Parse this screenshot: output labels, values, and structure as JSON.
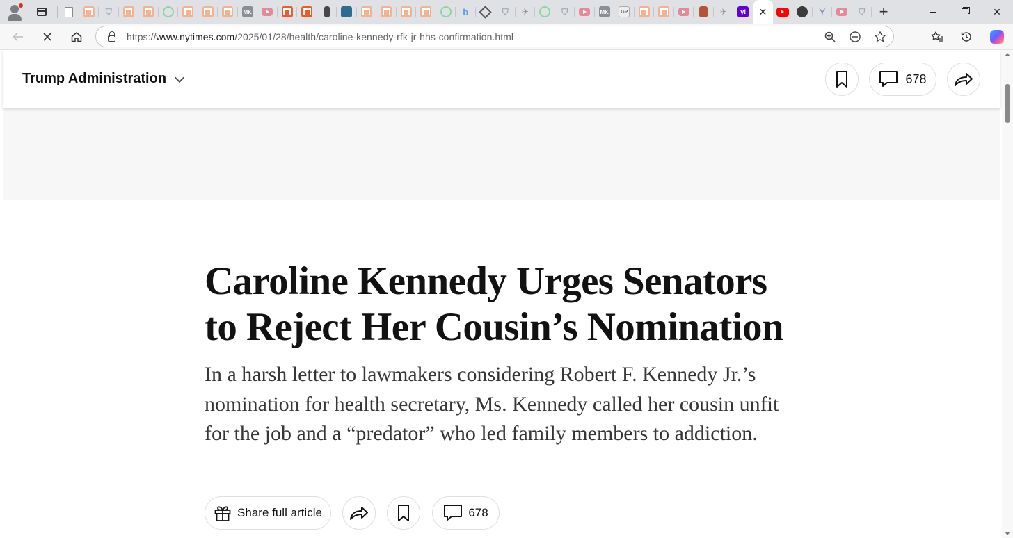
{
  "browser": {
    "url_prefix": "https://",
    "url_host": "www.nytimes.com",
    "url_path": "/2025/01/28/health/caroline-kennedy-rfk-jr-hhs-confirmation.html",
    "close_tab_glyph": "✕",
    "new_tab_glyph": "+",
    "window_close_glyph": "✕",
    "icons": [
      "back-icon",
      "stop-loading-icon",
      "home-icon",
      "lock-icon",
      "zoom-icon",
      "read-aloud-icon",
      "favorite-star-icon",
      "favorites-icon",
      "history-icon",
      "copilot-icon"
    ]
  },
  "tabstrip": {
    "favicons": [
      "doc",
      "orange",
      "shield",
      "orange",
      "orange",
      "play",
      "orange",
      "orange",
      "orange",
      "gray",
      "pinkred",
      "red-orange",
      "red-orange",
      "dark",
      "teal",
      "orange",
      "orange",
      "orange",
      "orange",
      "play",
      "blue-b",
      "diamond",
      "shield",
      "bird",
      "play",
      "shield",
      "pinkred",
      "gray",
      "gp",
      "orange",
      "orange",
      "pinkred",
      "brown",
      "bird",
      "purple"
    ],
    "favicon_labels": {
      "gray": "MK",
      "gp": "GP",
      "purple": "y!",
      "blue-b": "b"
    },
    "after_active": [
      "ytred",
      "circle-dark",
      "y",
      "pinkred",
      "shield"
    ]
  },
  "sticky_header": {
    "section_label": "Trump Administration",
    "comment_count": "678"
  },
  "article": {
    "headline": "Caroline Kennedy Urges Senators to Reject Her Cousin’s Nomination",
    "summary": "In a harsh letter to lawmakers considering Robert F. Kennedy Jr.’s nomination for health secretary, Ms. Kennedy called her cousin unfit for the job and a “predator” who led family members to addiction.",
    "share_full_article_label": "Share full article",
    "comment_count": "678"
  }
}
